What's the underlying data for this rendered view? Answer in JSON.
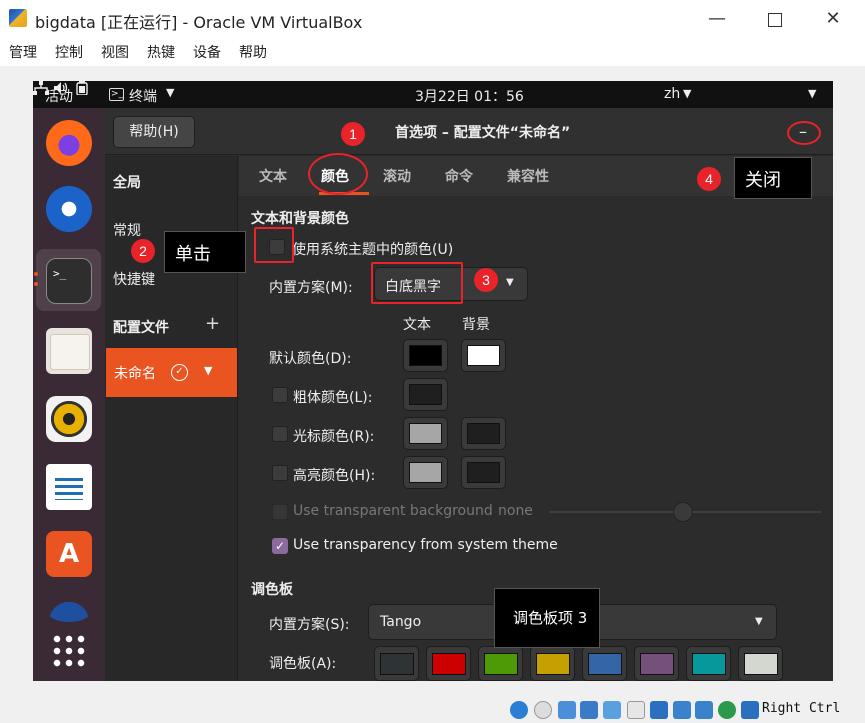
{
  "host": {
    "title": "bigdata [正在运行] - Oracle VM VirtualBox",
    "menu": [
      "管理",
      "控制",
      "视图",
      "热键",
      "设备",
      "帮助"
    ],
    "minimize_glyph": "—",
    "close_glyph": "✕",
    "hostkey": "Right Ctrl"
  },
  "guest_topbar": {
    "activities": "活动",
    "app_name": "终端",
    "clock": "3月22日  01：56",
    "lang": "zh"
  },
  "prefs": {
    "help_button": "帮助(H)",
    "title": "首选项 – 配置文件“未命名”",
    "minimize_glyph": "–",
    "sidebar": {
      "global": "全局",
      "general": "常规",
      "shortcuts": "快捷键",
      "profiles": "配置文件",
      "add": "+",
      "profile_name": "未命名"
    },
    "tabs": [
      "文本",
      "颜色",
      "滚动",
      "命令",
      "兼容性"
    ],
    "active_tab": "颜色",
    "colors": {
      "section_title": "文本和背景颜色",
      "use_system_theme": "使用系统主题中的颜色(U)",
      "builtin_scheme_label": "内置方案(M):",
      "builtin_scheme_value": "白底黑字",
      "col_text": "文本",
      "col_bg": "背景",
      "default_color": "默认颜色(D):",
      "bold_color": "粗体颜色(L):",
      "cursor_color": "光标颜色(R):",
      "highlight_color": "高亮颜色(H):",
      "transparent_bg": "Use transparent background",
      "transparent_none": "none",
      "use_system_transparency": "Use transparency from system theme",
      "swatches": {
        "default_text": "#000000",
        "default_bg": "#ffffff",
        "bold_text": "#1f1f1f",
        "cursor_text": "#a6a6a6",
        "cursor_bg": "#1f1f1f",
        "highlight_text": "#a6a6a6",
        "highlight_bg": "#1f1f1f"
      }
    },
    "palette": {
      "section_title": "调色板",
      "builtin_scheme_label": "内置方案(S):",
      "builtin_scheme_value": "Tango",
      "palette_label": "调色板(A):",
      "colors": [
        "#2e3436",
        "#cc0000",
        "#4e9a06",
        "#c4a000",
        "#3465a4",
        "#75507b",
        "#06989a",
        "#d3d7cf"
      ]
    }
  },
  "annotations": {
    "badge1": "1",
    "badge2": "2",
    "badge3": "3",
    "badge4": "4",
    "note_click": "单击",
    "note_close": "关闭",
    "note_palette": "调色板项 3"
  },
  "accent": "#e95420",
  "annotation_color": "#e8232a"
}
